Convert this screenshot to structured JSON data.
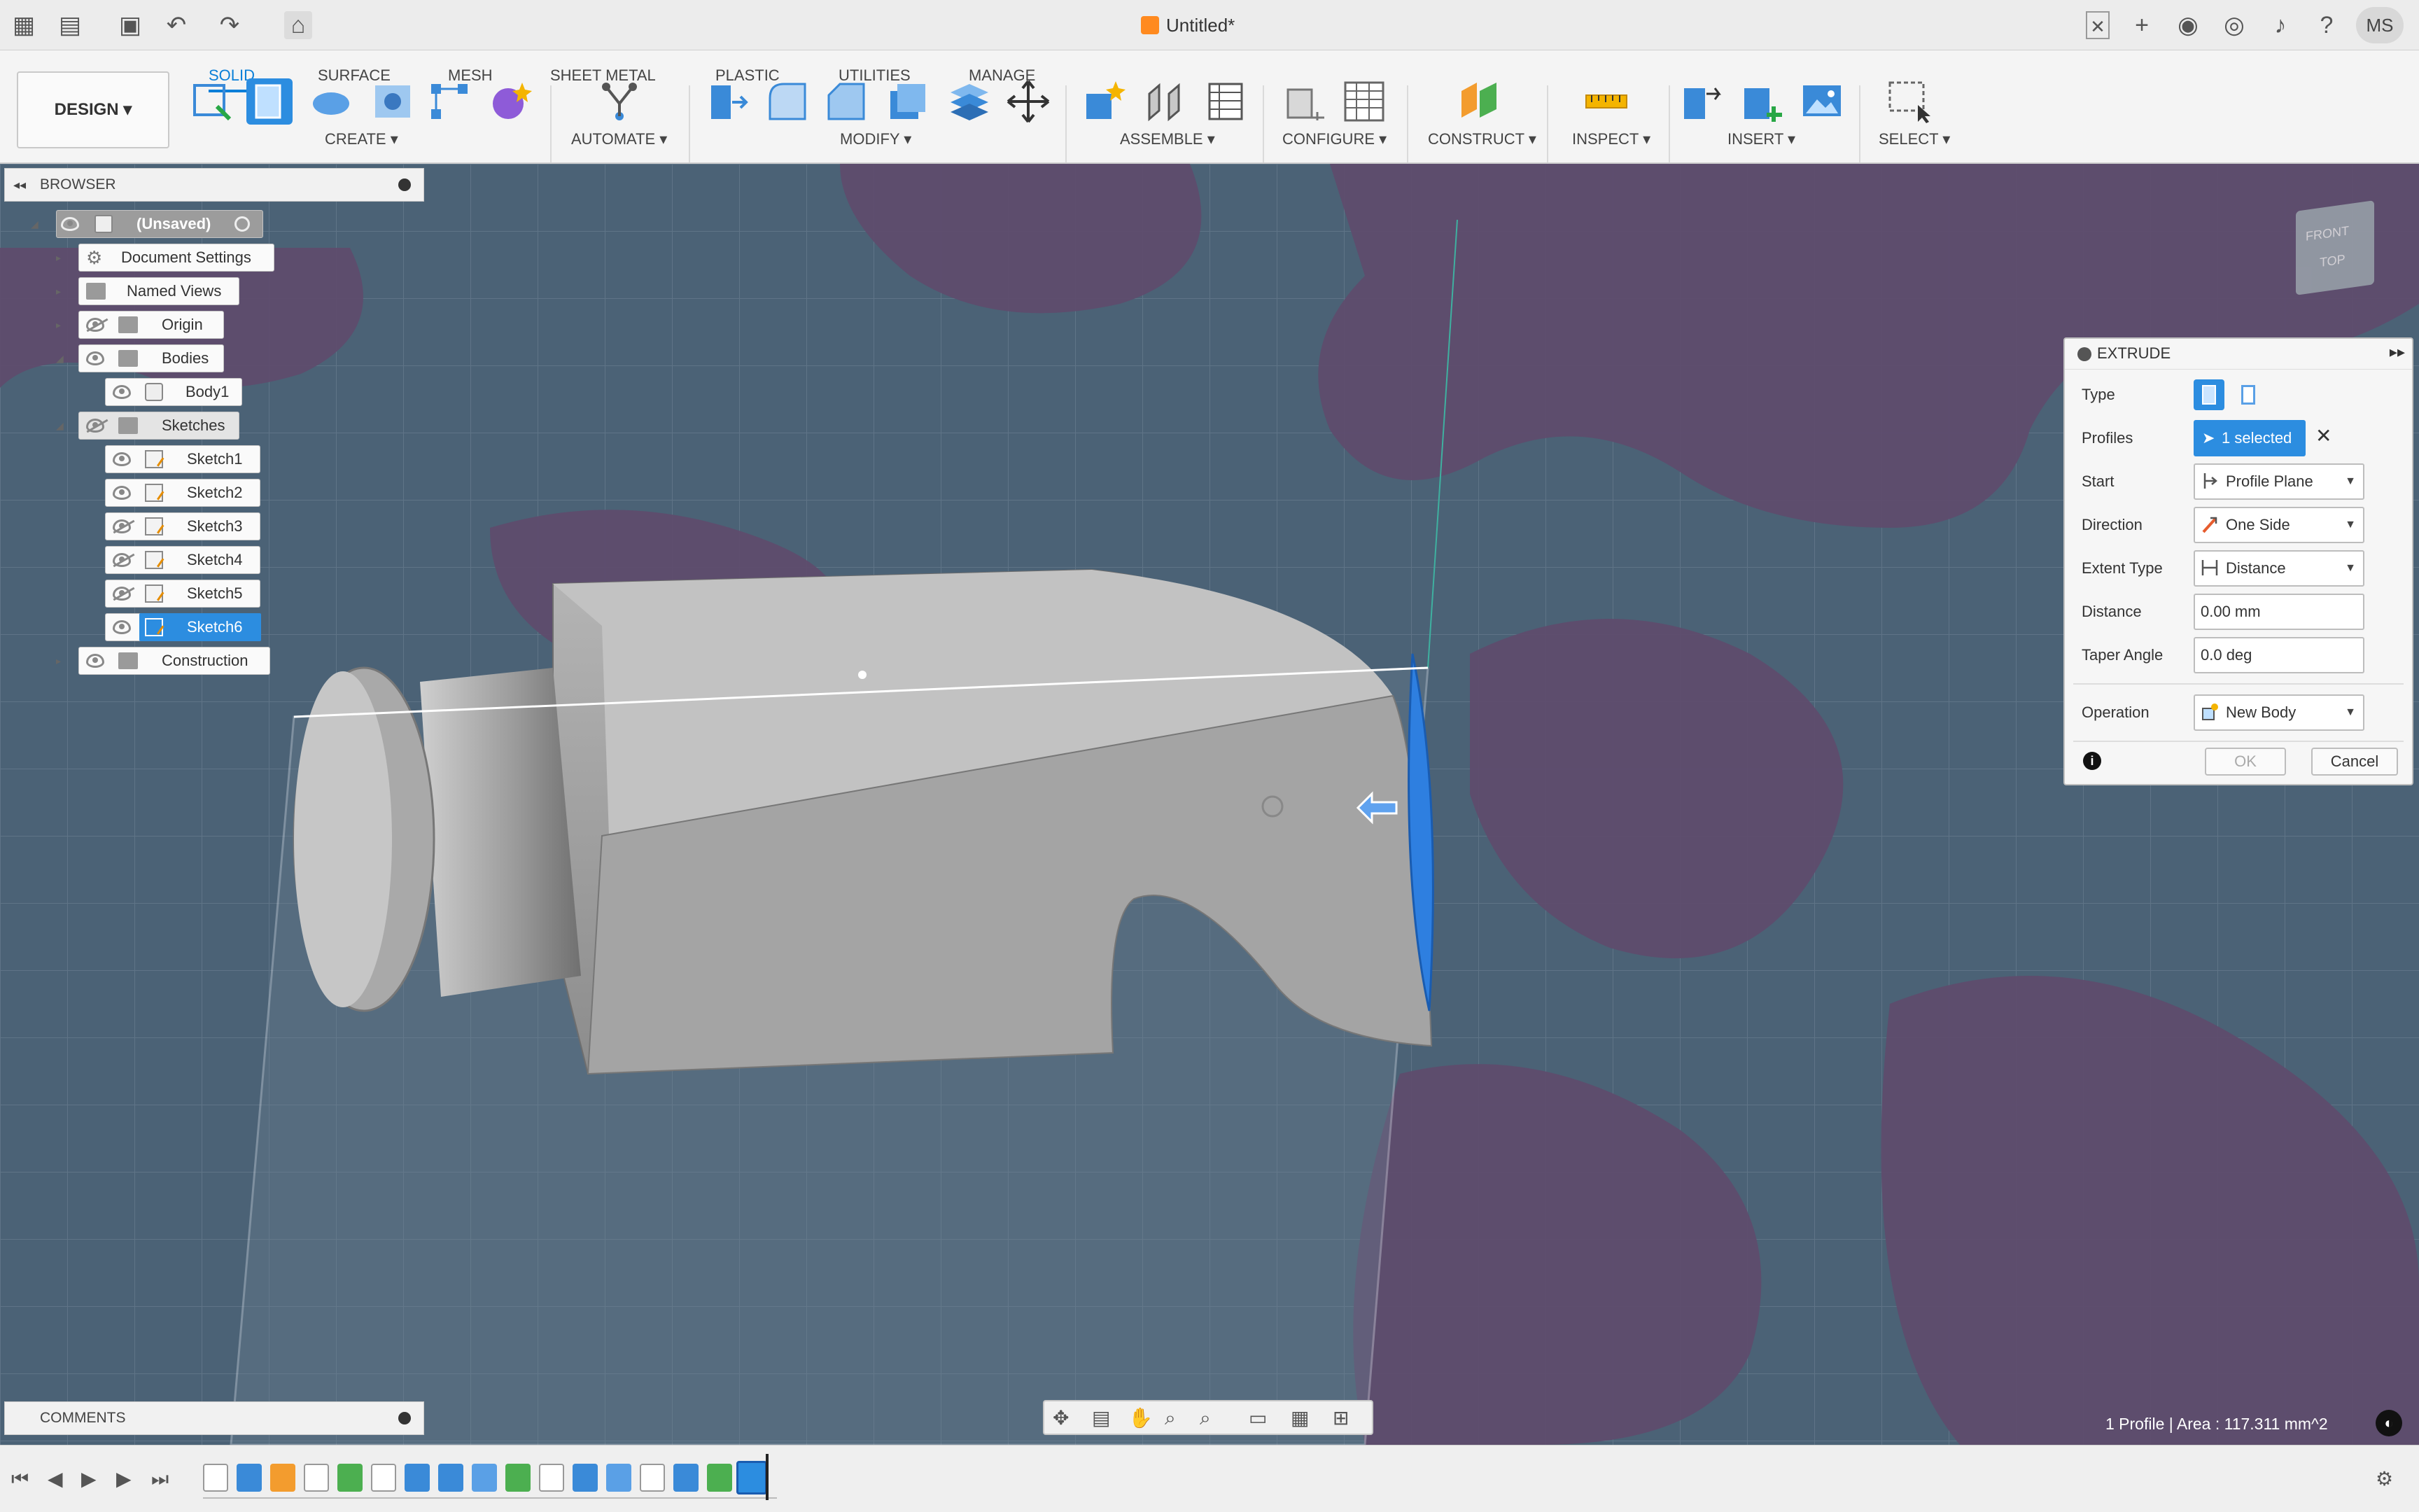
{
  "app": {
    "title": "Untitled*",
    "user_initials": "MS"
  },
  "toolbar": {
    "workspace": "DESIGN",
    "tabs": [
      "SOLID",
      "SURFACE",
      "MESH",
      "SHEET METAL",
      "PLASTIC",
      "UTILITIES",
      "MANAGE"
    ],
    "active_tab": "SOLID",
    "groups": [
      "CREATE ▾",
      "AUTOMATE ▾",
      "MODIFY ▾",
      "ASSEMBLE ▾",
      "CONFIGURE ▾",
      "CONSTRUCT ▾",
      "INSPECT ▾",
      "INSERT ▾",
      "SELECT ▾"
    ]
  },
  "browser": {
    "title": "BROWSER",
    "root": "(Unsaved)",
    "items": [
      "Document Settings",
      "Named Views",
      "Origin",
      "Bodies",
      "Body1",
      "Sketches",
      "Sketch1",
      "Sketch2",
      "Sketch3",
      "Sketch4",
      "Sketch5",
      "Sketch6",
      "Construction"
    ],
    "selected": "Sketch6"
  },
  "extrude": {
    "title": "EXTRUDE",
    "labels": {
      "type": "Type",
      "profiles": "Profiles",
      "start": "Start",
      "direction": "Direction",
      "extent_type": "Extent Type",
      "distance": "Distance",
      "taper_angle": "Taper Angle",
      "operation": "Operation"
    },
    "profiles_value": "1 selected",
    "start_value": "Profile Plane",
    "direction_value": "One Side",
    "extent_value": "Distance",
    "distance_value": "0.00 mm",
    "taper_value": "0.0 deg",
    "operation_value": "New Body",
    "ok_label": "OK",
    "cancel_label": "Cancel"
  },
  "viewcube": {
    "labels": [
      "FRONT",
      "TOP"
    ]
  },
  "comments": {
    "title": "COMMENTS"
  },
  "status_text": "1 Profile | Area : 117.311 mm^2",
  "colors": {
    "accent": "#0a7fd8",
    "selection": "#2c8de0",
    "viewport": "#4b6276",
    "purple_bg": "#5e4b6c"
  }
}
